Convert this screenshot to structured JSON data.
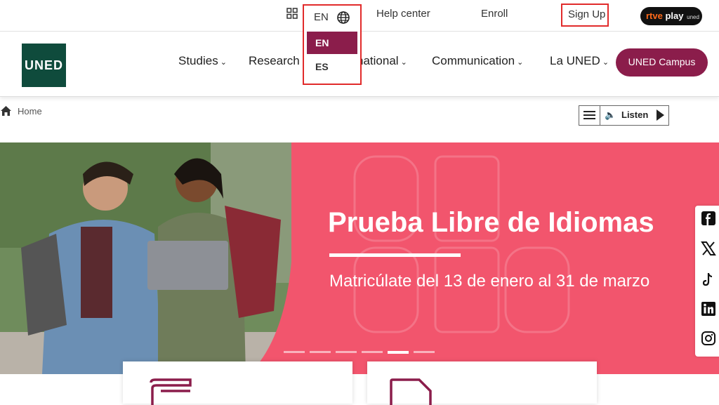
{
  "topbar": {
    "apps_icon": "grid-icon",
    "language": {
      "current": "EN",
      "icon": "globe-icon",
      "options": [
        {
          "label": "EN",
          "selected": true
        },
        {
          "label": "ES",
          "selected": false
        }
      ]
    },
    "help_center": "Help center",
    "enroll": "Enroll",
    "sign_up": "Sign Up",
    "rtve": {
      "brand": "rtve",
      "play": "play",
      "suffix": "uned"
    }
  },
  "header": {
    "logo_text": "UNED",
    "nav": [
      {
        "label": "Studies"
      },
      {
        "label": "Research"
      },
      {
        "label": "national"
      },
      {
        "label": "Communication"
      },
      {
        "label": "La UNED"
      }
    ],
    "campus_button": "UNED Campus"
  },
  "breadcrumb": {
    "home_label": "Home",
    "icon": "home-icon"
  },
  "listen_widget": {
    "label": "Listen",
    "icons": [
      "menu-icon",
      "speaker-icon",
      "play-icon"
    ]
  },
  "hero": {
    "title": "Prueba Libre de Idiomas",
    "subtitle": "Matricúlate del 13 de enero al 31 de marzo",
    "slides_count": 6,
    "active_slide": 5
  },
  "social": [
    "facebook-icon",
    "x-icon",
    "tiktok-icon",
    "linkedin-icon",
    "instagram-icon"
  ],
  "colors": {
    "brand_maroon": "#8b1d4b",
    "logo_green": "#0f4b3c",
    "hero_pink": "#f2556d",
    "highlight_red": "#e12b2b"
  }
}
